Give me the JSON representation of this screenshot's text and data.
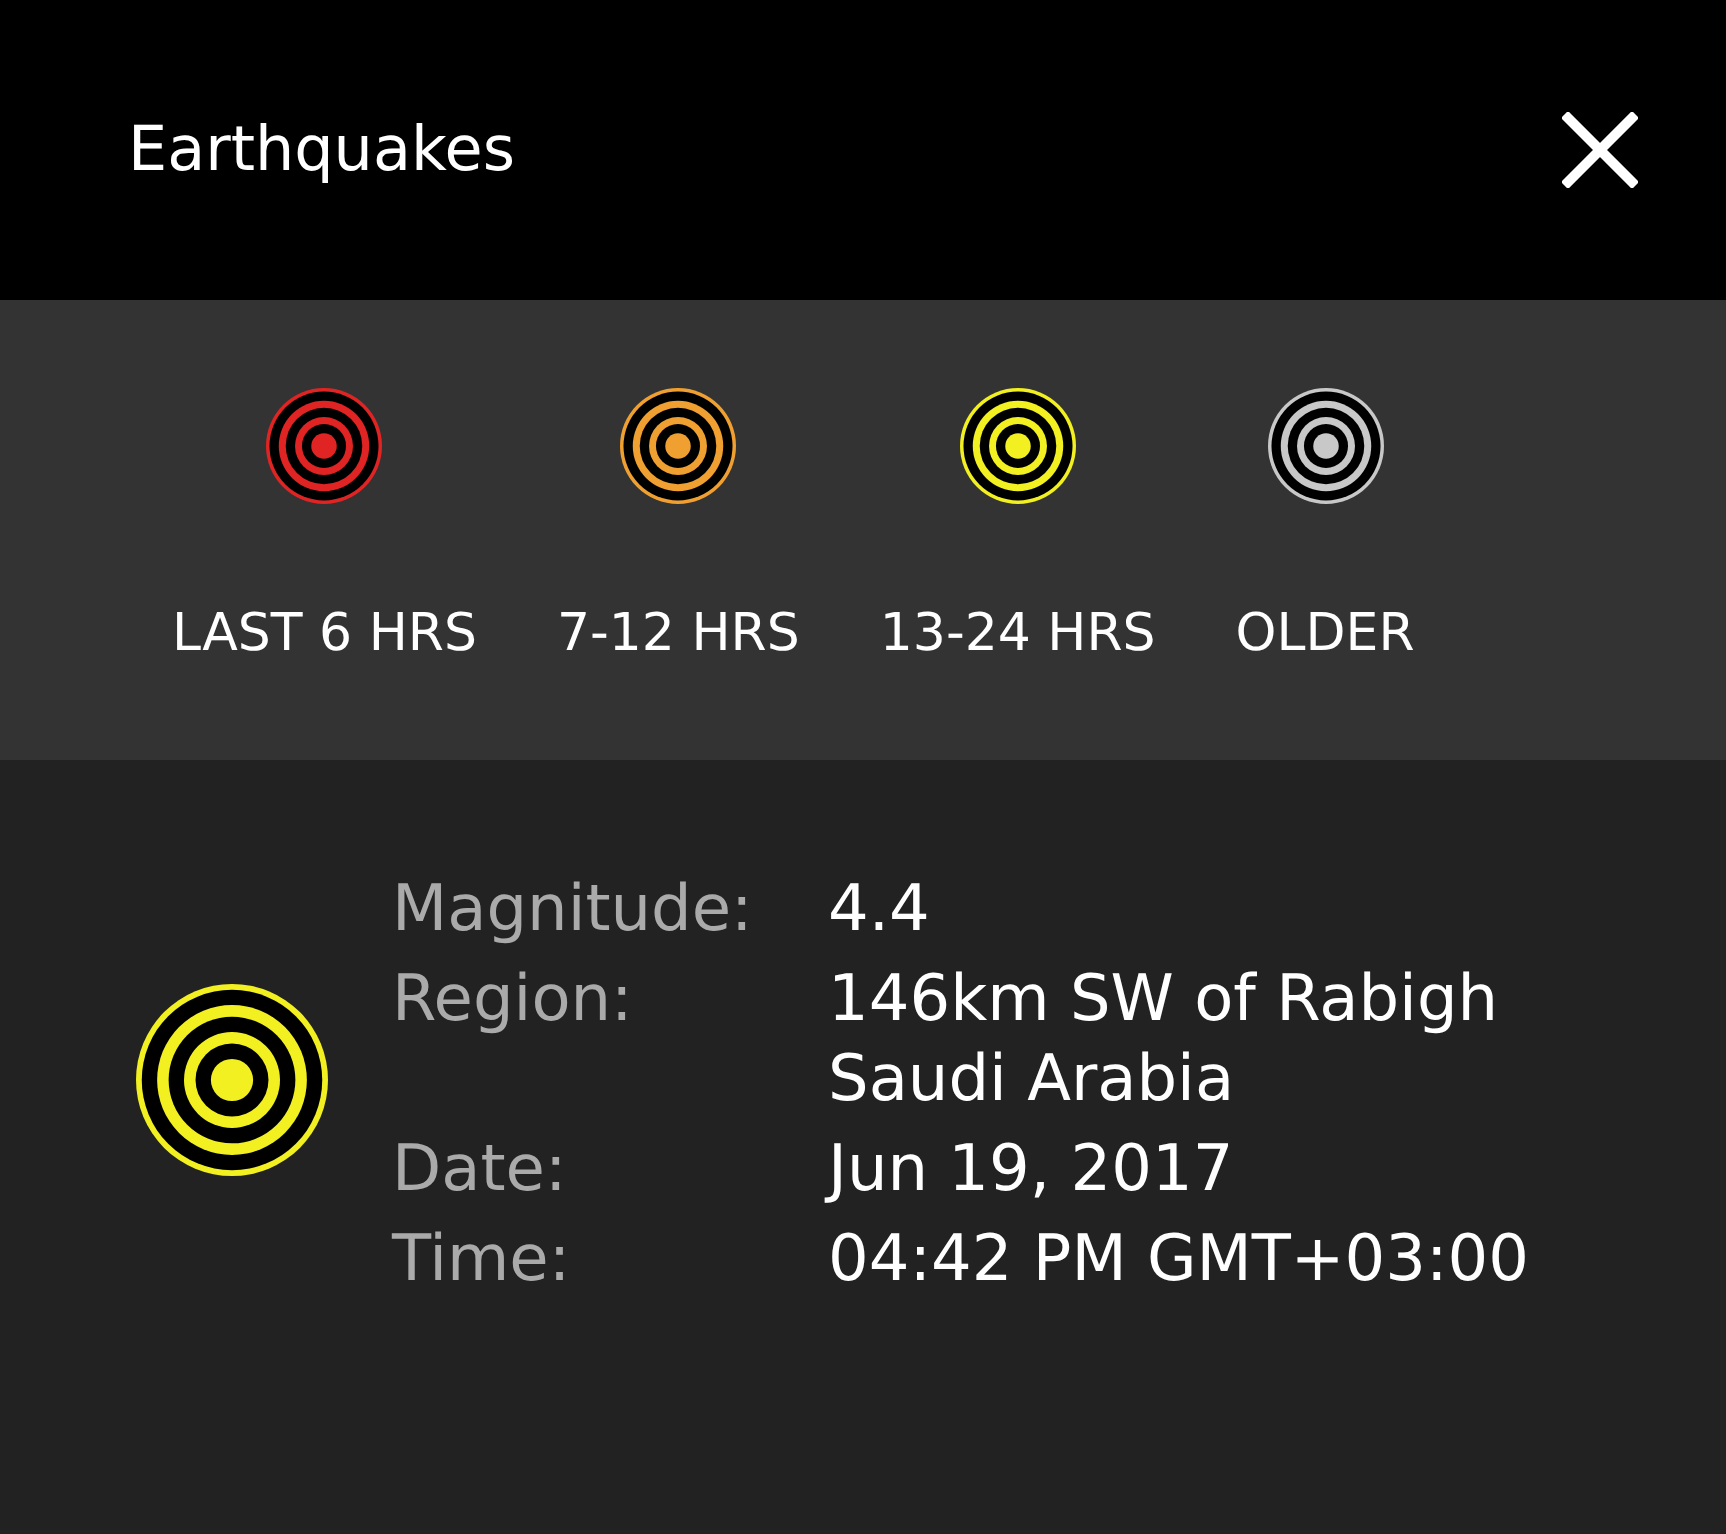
{
  "header": {
    "title": "Earthquakes"
  },
  "legend": [
    {
      "label": "LAST 6 HRS",
      "color": "#e02424"
    },
    {
      "label": "7-12 HRS",
      "color": "#f0a030"
    },
    {
      "label": "13-24 HRS",
      "color": "#f2f020"
    },
    {
      "label": "OLDER",
      "color": "#c8c8c8"
    }
  ],
  "detail": {
    "color": "#f2f020",
    "fields": [
      {
        "label": "Magnitude:",
        "lines": [
          "4.4"
        ]
      },
      {
        "label": "Region:",
        "lines": [
          "146km SW of Rabigh",
          "Saudi Arabia"
        ]
      },
      {
        "label": "Date:",
        "lines": [
          "Jun 19, 2017"
        ]
      },
      {
        "label": "Time:",
        "lines": [
          "04:42 PM GMT+03:00"
        ]
      }
    ]
  }
}
